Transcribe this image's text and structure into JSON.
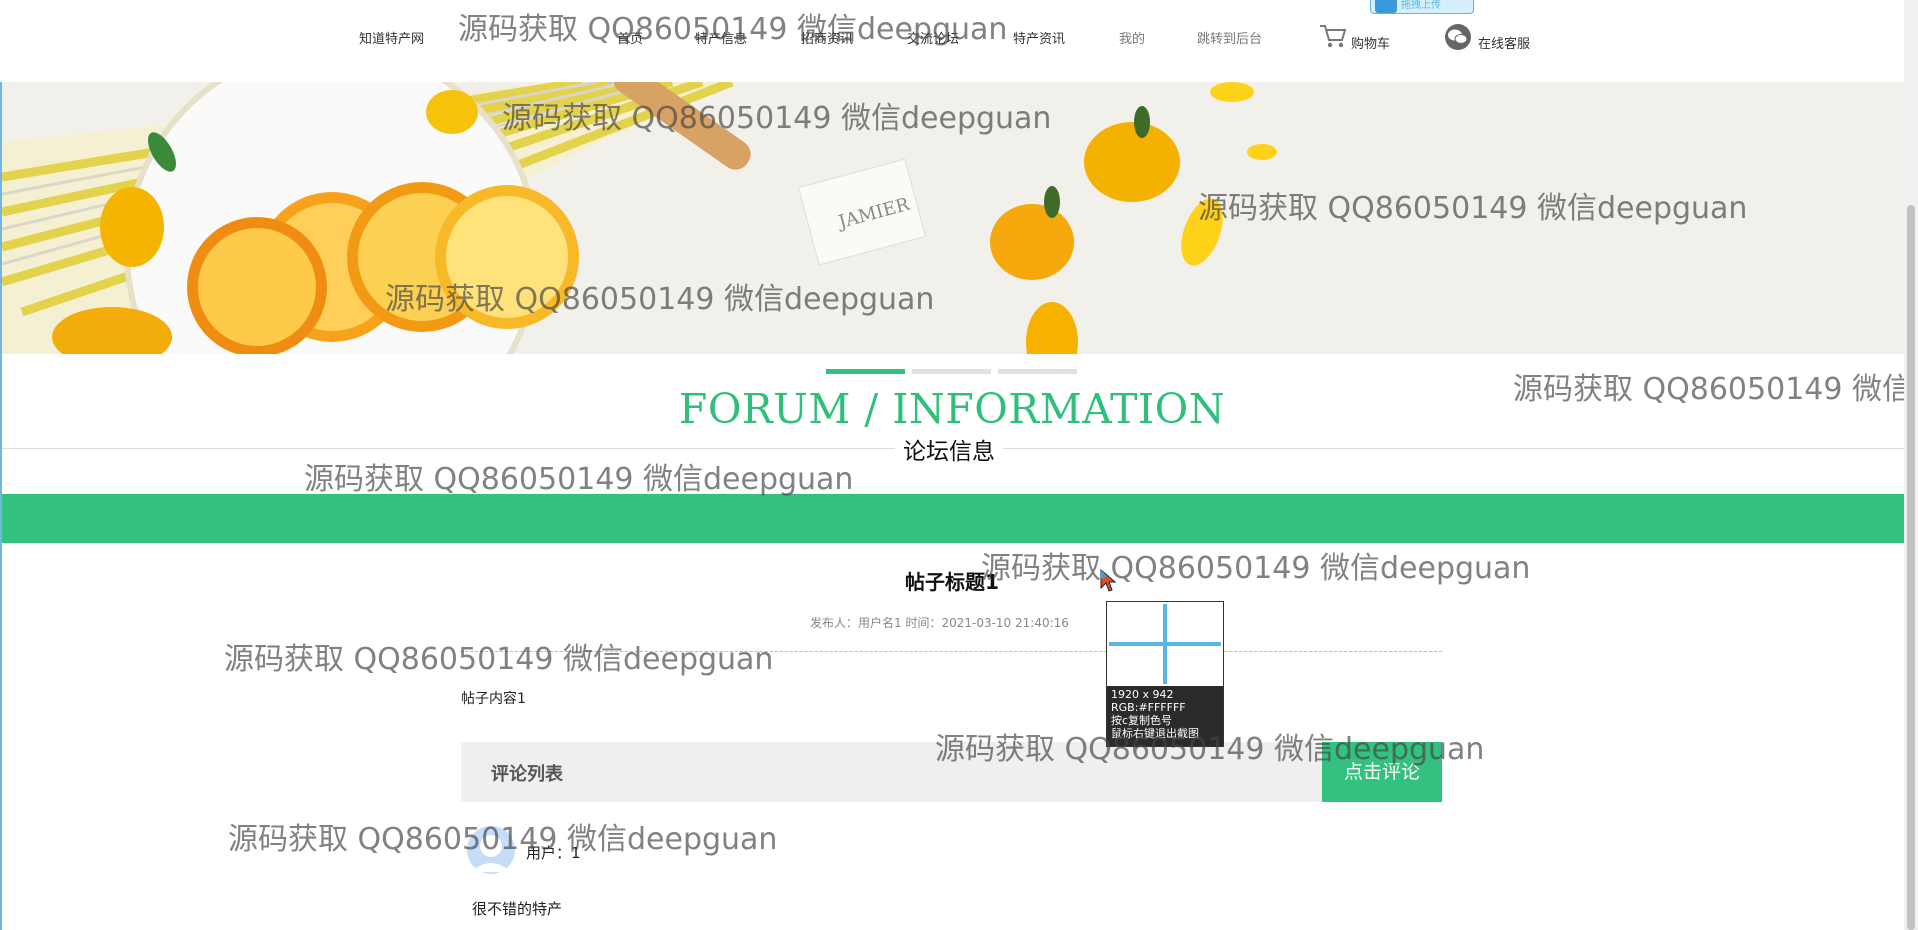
{
  "nav": {
    "brand": "知道特产网",
    "items": [
      "首页",
      "特产信息",
      "招商资讯",
      "交流论坛",
      "特产资讯",
      "我的",
      "跳转到后台"
    ],
    "cart": "购物车",
    "service": "在线客服"
  },
  "upload_badge": "拖拽上传",
  "section": {
    "title_en": "FORUM / INFORMATION",
    "title_cn": "论坛信息"
  },
  "post": {
    "title": "帖子标题1",
    "meta": "发布人：用户名1 时间：2021-03-10 21:40:16",
    "content": "帖子内容1"
  },
  "comments": {
    "header": "评论列表",
    "button": "点击评论",
    "items": [
      {
        "user": "用户：1",
        "text": "很不错的特产"
      }
    ]
  },
  "picker": {
    "size": "1920 x 942",
    "rgb": "RGB:#FFFFFF",
    "copy": "按c复制色号",
    "close": "鼠标右键退出截图"
  },
  "watermark": "源码获取 QQ86050149 微信deepguan",
  "colors": {
    "accent": "#32c17e",
    "title": "#2fbf7a"
  }
}
